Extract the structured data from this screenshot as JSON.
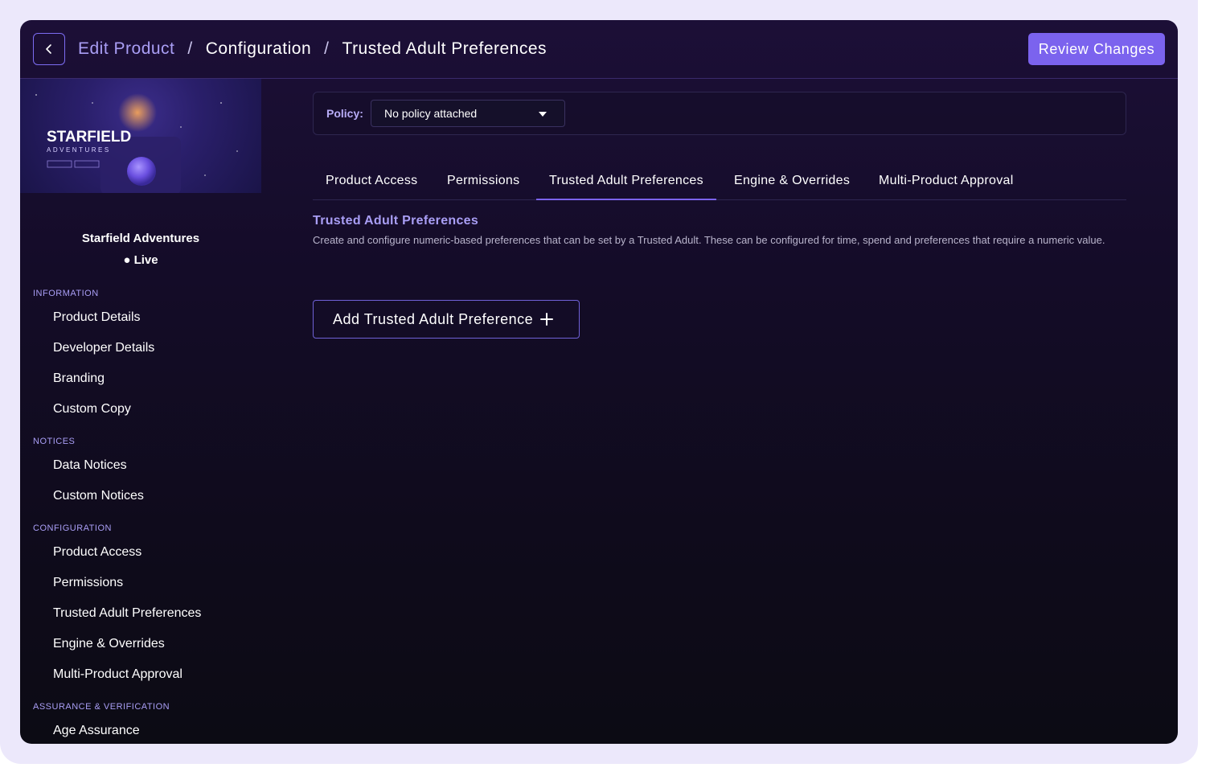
{
  "header": {
    "breadcrumb": [
      "Edit Product",
      "/",
      "Configuration",
      "/",
      "Trusted Adult Preferences"
    ],
    "review_button": "Review Changes"
  },
  "sidebar": {
    "thumbnail": {
      "title": "STARFIELD",
      "subtitle": "ADVENTURES"
    },
    "product_name": "Starfield Adventures",
    "status": "● Live",
    "sections": [
      {
        "title": "INFORMATION",
        "items": [
          "Product Details",
          "Developer Details",
          "Branding",
          "Custom Copy"
        ]
      },
      {
        "title": "NOTICES",
        "items": [
          "Data Notices",
          "Custom Notices"
        ]
      },
      {
        "title": "CONFIGURATION",
        "items": [
          "Product Access",
          "Permissions",
          "Trusted Adult Preferences",
          "Engine & Overrides",
          "Multi-Product Approval"
        ]
      },
      {
        "title": "ASSURANCE & VERIFICATION",
        "items": [
          "Age Assurance"
        ]
      }
    ]
  },
  "policy": {
    "label": "Policy:",
    "selected": "No policy attached"
  },
  "tabs": [
    "Product Access",
    "Permissions",
    "Trusted Adult Preferences",
    "Engine & Overrides",
    "Multi-Product Approval"
  ],
  "active_tab": "Trusted Adult Preferences",
  "content": {
    "heading": "Trusted Adult Preferences",
    "description": "Create and configure numeric-based preferences that can be set by a Trusted Adult. These can be configured for time, spend and preferences that require a numeric value.",
    "add_button": "Add Trusted Adult Preference"
  },
  "colors": {
    "accent": "#7b63ee",
    "accent_text": "#a99ef5",
    "background": "#140c28"
  }
}
